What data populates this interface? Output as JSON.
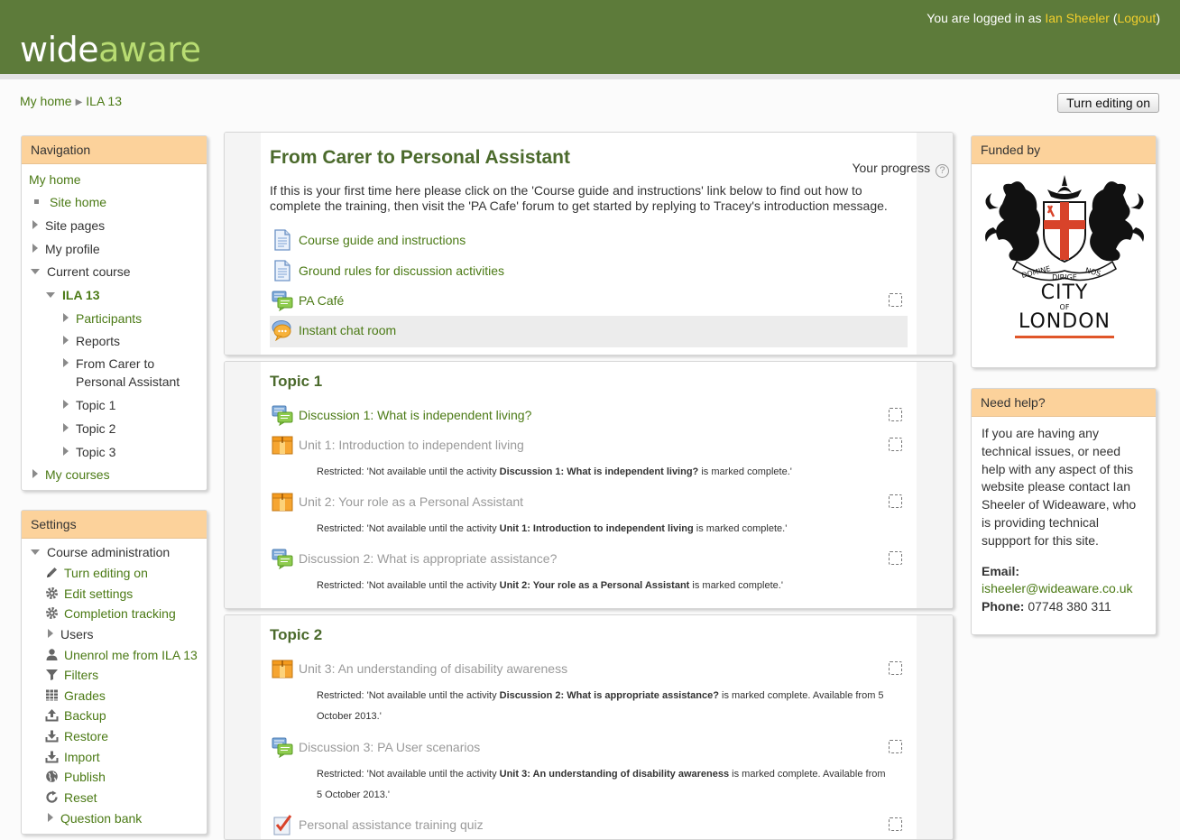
{
  "header": {
    "logo_part1": "wide",
    "logo_part2": "aware",
    "login_prefix": "You are logged in as ",
    "user_name": "Ian Sheeler",
    "logout_open": " (",
    "logout_label": "Logout",
    "logout_close": ")"
  },
  "breadcrumb": {
    "items": [
      "My home",
      "ILA 13"
    ],
    "separator": "▶"
  },
  "edit_button": "Turn editing on",
  "navigation": {
    "title": "Navigation",
    "my_home": "My home",
    "site_home": "Site home",
    "site_pages": "Site pages",
    "my_profile": "My profile",
    "current_course": "Current course",
    "course": "ILA 13",
    "participants": "Participants",
    "reports": "Reports",
    "section_0_line1": "From Carer to",
    "section_0_line2": "Personal Assistant",
    "topic_1": "Topic 1",
    "topic_2": "Topic 2",
    "topic_3": "Topic 3",
    "my_courses": "My courses"
  },
  "settings": {
    "title": "Settings",
    "course_admin": "Course administration",
    "items": [
      {
        "label": "Turn editing on",
        "icon": "pencil-icon"
      },
      {
        "label": "Edit settings",
        "icon": "gear-icon"
      },
      {
        "label": "Completion tracking",
        "icon": "gear-icon"
      },
      {
        "label": "Users",
        "icon": "expand-arrow"
      },
      {
        "label": "Unenrol me from ILA 13",
        "icon": "user-icon"
      },
      {
        "label": "Filters",
        "icon": "filter-icon"
      },
      {
        "label": "Grades",
        "icon": "grades-icon"
      },
      {
        "label": "Backup",
        "icon": "backup-icon"
      },
      {
        "label": "Restore",
        "icon": "restore-icon"
      },
      {
        "label": "Import",
        "icon": "import-icon"
      },
      {
        "label": "Publish",
        "icon": "globe-icon"
      },
      {
        "label": "Reset",
        "icon": "reset-icon"
      },
      {
        "label": "Question bank",
        "icon": "expand-arrow"
      }
    ]
  },
  "course": {
    "title": "From Carer to Personal Assistant",
    "progress_label": "Your progress",
    "intro_line1": "If this is your first time here please click on the 'Course guide and instructions' link below to find out how to",
    "intro_line2": "complete the training, then visit the 'PA Cafe' forum to get started by replying to Tracey's introduction message.",
    "section0_activities": [
      {
        "name": "Course guide and instructions",
        "icon": "page-icon"
      },
      {
        "name": "Ground rules for discussion activities",
        "icon": "page-icon"
      },
      {
        "name": "PA Café",
        "icon": "forum-icon"
      },
      {
        "name": "Instant chat room",
        "icon": "chat-icon"
      }
    ],
    "topic1": {
      "title": "Topic 1",
      "activities": [
        {
          "name": "Discussion 1: What is independent living?",
          "icon": "forum-icon"
        },
        {
          "name": "Unit 1: Introduction to independent living",
          "icon": "package-icon",
          "restriction": {
            "pre": "Restricted: 'Not available until the activity ",
            "bold": "Discussion 1: What is independent living?",
            "post": " is marked complete.'"
          }
        },
        {
          "name": "Unit 2: Your role as a Personal Assistant",
          "icon": "package-icon",
          "restriction": {
            "pre": "Restricted: 'Not available until the activity ",
            "bold": "Unit 1: Introduction to independent living",
            "post": " is marked complete.'"
          }
        },
        {
          "name": "Discussion 2: What is appropriate assistance?",
          "icon": "forum-icon",
          "restriction": {
            "pre": "Restricted: 'Not available until the activity ",
            "bold": "Unit 2: Your role as a Personal Assistant",
            "post": " is marked complete.'"
          }
        }
      ]
    },
    "topic2": {
      "title": "Topic 2",
      "activities": [
        {
          "name": "Unit 3: An understanding of disability awareness",
          "icon": "package-icon",
          "restriction": {
            "pre": "Restricted: 'Not available until the activity ",
            "bold": "Discussion 2: What is appropriate assistance?",
            "post": " is marked complete. Available from 5",
            "line2": "October 2013.'"
          }
        },
        {
          "name": "Discussion 3: PA User scenarios",
          "icon": "forum-icon",
          "restriction": {
            "pre": "Restricted: 'Not available until the activity ",
            "bold": "Unit 3: An understanding of disability awareness",
            "post": " is marked complete. Available from",
            "line2": "5 October 2013.'"
          }
        },
        {
          "name": "Personal assistance training quiz",
          "icon": "quiz-icon"
        }
      ]
    }
  },
  "funded": {
    "title": "Funded by",
    "logo_text_1": "CITY",
    "logo_text_2": "OF",
    "logo_text_3": "LONDON",
    "motto_left": "DOMINE",
    "motto_mid": "DIRIGE",
    "motto_right": "NOS"
  },
  "help": {
    "title": "Need help?",
    "lines": [
      "If you are having any",
      "technical issues, or need",
      "help with any aspect of this",
      "website please contact Ian",
      "Sheeler of Wideaware, who",
      "is providing technical",
      "suppport for this site."
    ],
    "email_label": "Email:",
    "email": "isheeler@wideaware.co.uk",
    "phone_label": "Phone:",
    "phone": " 07748 380 311"
  },
  "colors": {
    "header_green": "#5d7b3a",
    "link_green": "#4b7a15",
    "block_header": "#fcd29b",
    "user_link_yellow": "#f2cf2c"
  }
}
